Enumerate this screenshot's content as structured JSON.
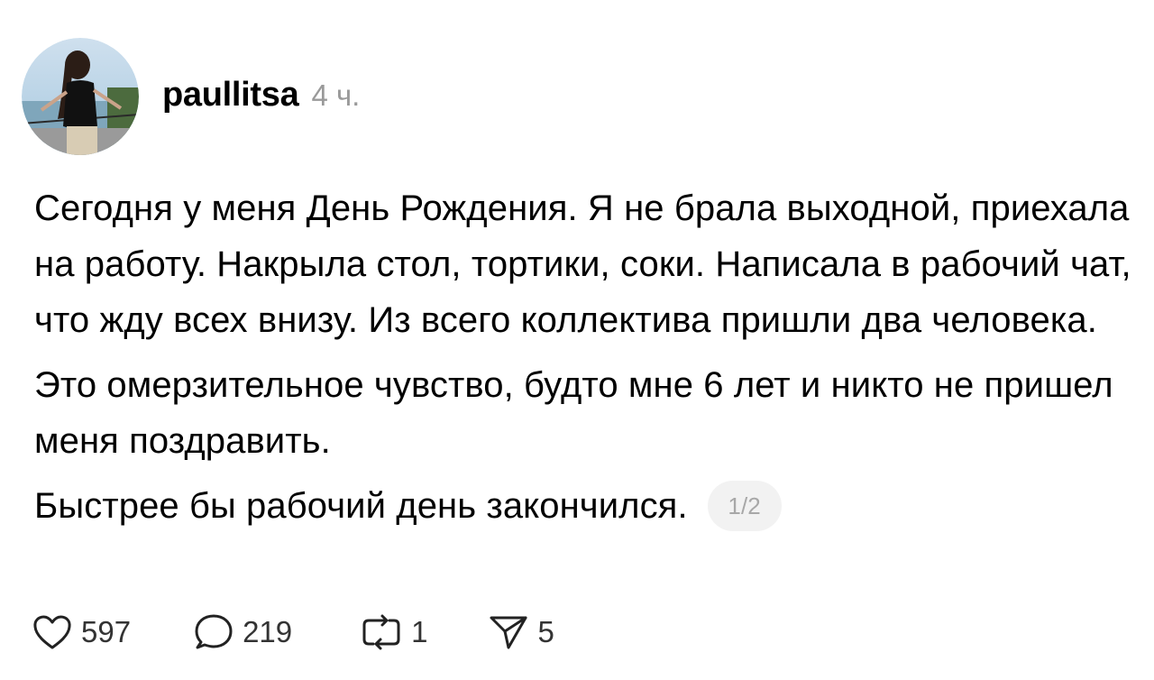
{
  "post": {
    "username": "paullitsa",
    "time": "4 ч.",
    "paragraphs": [
      "Сегодня у меня День Рождения. Я не брала выходной, приехала на работу. Накрыла стол, тортики, соки. Написала в рабочий чат, что жду всех внизу. Из всего коллектива пришли два человека.",
      "Это омерзительное чувство, будто мне 6 лет и никто не пришел меня поздравить.",
      "Быстрее бы рабочий день закончился."
    ],
    "page_indicator": "1/2"
  },
  "actions": {
    "likes": "597",
    "comments": "219",
    "reposts": "1",
    "shares": "5"
  },
  "icons": {
    "like": "heart-icon",
    "comment": "speech-bubble-icon",
    "repost": "repost-arrows-icon",
    "share": "paper-plane-icon"
  }
}
